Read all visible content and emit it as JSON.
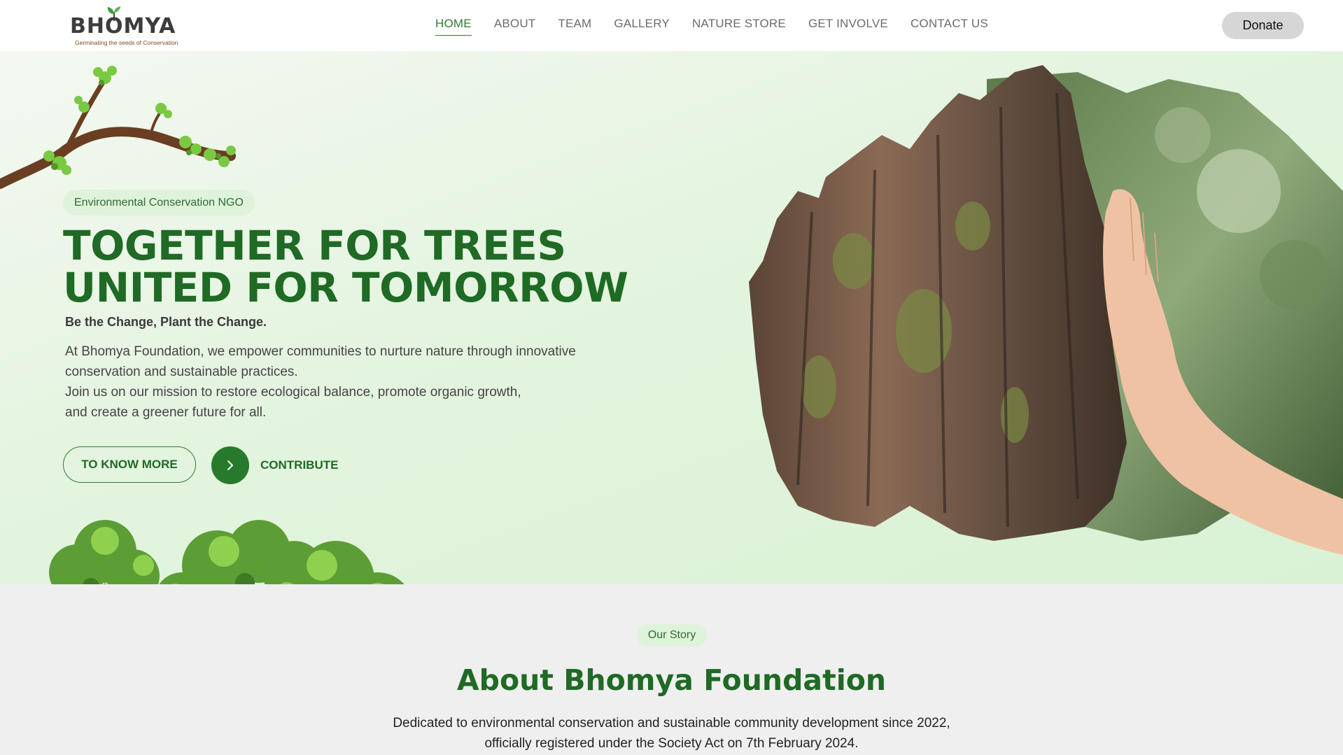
{
  "brand": {
    "name": "BHOMYA",
    "tagline": "Germinating the seeds of Conservation"
  },
  "nav": {
    "items": [
      {
        "label": "HOME",
        "active": true
      },
      {
        "label": "ABOUT"
      },
      {
        "label": "TEAM"
      },
      {
        "label": "GALLERY"
      },
      {
        "label": "NATURE STORE"
      },
      {
        "label": "GET INVOLVE"
      },
      {
        "label": "CONTACT US"
      }
    ],
    "donate_label": "Donate"
  },
  "hero": {
    "badge": "Environmental Conservation NGO",
    "title_line1": "TOGETHER FOR TREES",
    "title_line2": "UNITED FOR TOMORROW",
    "tagline": "Be the Change, Plant the Change.",
    "description_lines": [
      "At Bhomya Foundation, we empower communities to nurture nature through innovative",
      "conservation and sustainable practices.",
      "Join us on our mission to restore ecological balance, promote organic growth,",
      "and create a greener future for all."
    ],
    "know_more_label": "TO KNOW MORE",
    "contribute_label": "CONTRIBUTE"
  },
  "about": {
    "badge": "Our Story",
    "title": "About Bhomya Foundation",
    "text_lines": [
      "Dedicated to environmental conservation and sustainable community development since 2022,",
      "officially registered under the Society Act on 7th February 2024."
    ]
  },
  "colors": {
    "primary": "#1f6a24",
    "accent": "#277a2b",
    "hero_bg": "#e3f4df",
    "badge_bg": "#dff2dc",
    "about_bg": "#efefef"
  },
  "icons": {
    "contribute": "chevron-right-icon",
    "logo": "sprout-icon"
  }
}
